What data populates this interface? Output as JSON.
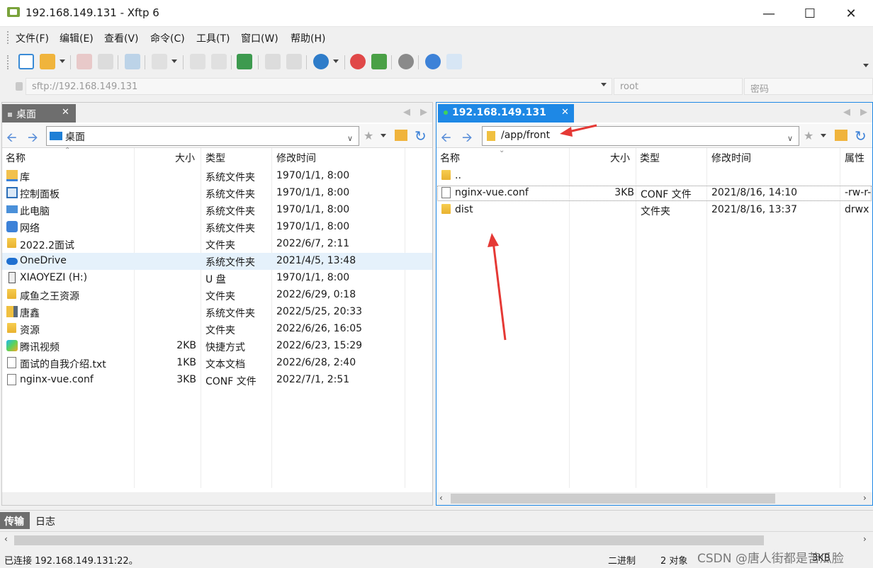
{
  "window": {
    "title": "192.168.149.131 - Xftp 6"
  },
  "menu": [
    "文件(F)",
    "编辑(E)",
    "查看(V)",
    "命令(C)",
    "工具(T)",
    "窗口(W)",
    "帮助(H)"
  ],
  "address": {
    "host": "sftp://192.168.149.131",
    "user": "root",
    "password": "密码"
  },
  "left": {
    "tab": "桌面",
    "path": "桌面",
    "columns": [
      "名称",
      "大小",
      "类型",
      "修改时间"
    ],
    "rows": [
      {
        "name": "库",
        "size": "",
        "type": "系统文件夹",
        "mtime": "1970/1/1, 8:00",
        "icon": "library-icon"
      },
      {
        "name": "控制面板",
        "size": "",
        "type": "系统文件夹",
        "mtime": "1970/1/1, 8:00",
        "icon": "control-panel-icon"
      },
      {
        "name": "此电脑",
        "size": "",
        "type": "系统文件夹",
        "mtime": "1970/1/1, 8:00",
        "icon": "computer-icon"
      },
      {
        "name": "网络",
        "size": "",
        "type": "系统文件夹",
        "mtime": "1970/1/1, 8:00",
        "icon": "network-icon"
      },
      {
        "name": "2022.2面试",
        "size": "",
        "type": "文件夹",
        "mtime": "2022/6/7, 2:11",
        "icon": "folder-icon"
      },
      {
        "name": "OneDrive",
        "size": "",
        "type": "系统文件夹",
        "mtime": "2021/4/5, 13:48",
        "icon": "cloud-icon"
      },
      {
        "name": "XIAOYEZI (H:)",
        "size": "",
        "type": "U 盘",
        "mtime": "1970/1/1, 8:00",
        "icon": "usb-drive-icon"
      },
      {
        "name": "咸鱼之王资源",
        "size": "",
        "type": "文件夹",
        "mtime": "2022/6/29, 0:18",
        "icon": "folder-icon"
      },
      {
        "name": "唐鑫",
        "size": "",
        "type": "系统文件夹",
        "mtime": "2022/5/25, 20:33",
        "icon": "user-folder-icon"
      },
      {
        "name": "资源",
        "size": "",
        "type": "文件夹",
        "mtime": "2022/6/26, 16:05",
        "icon": "folder-icon"
      },
      {
        "name": "腾讯视频",
        "size": "2KB",
        "type": "快捷方式",
        "mtime": "2022/6/23, 15:29",
        "icon": "video-shortcut-icon"
      },
      {
        "name": "面试的自我介绍.txt",
        "size": "1KB",
        "type": "文本文档",
        "mtime": "2022/6/28, 2:40",
        "icon": "text-file-icon"
      },
      {
        "name": "nginx-vue.conf",
        "size": "3KB",
        "type": "CONF 文件",
        "mtime": "2022/7/1, 2:51",
        "icon": "file-icon"
      }
    ]
  },
  "right": {
    "tab": "192.168.149.131",
    "path": "/app/front",
    "columns": [
      "名称",
      "大小",
      "类型",
      "修改时间",
      "属性"
    ],
    "rows": [
      {
        "name": "..",
        "size": "",
        "type": "",
        "mtime": "",
        "attr": "",
        "icon": "folder-icon"
      },
      {
        "name": "nginx-vue.conf",
        "size": "3KB",
        "type": "CONF 文件",
        "mtime": "2021/8/16, 14:10",
        "attr": "-rw-r-",
        "icon": "file-icon"
      },
      {
        "name": "dist",
        "size": "",
        "type": "文件夹",
        "mtime": "2021/8/16, 13:37",
        "attr": "drwx",
        "icon": "folder-icon"
      }
    ]
  },
  "bottom_tabs": [
    "传输",
    "日志"
  ],
  "status": {
    "left": "已连接 192.168.149.131:22。",
    "mode": "二进制",
    "count": "2 对象",
    "size": "3KB"
  },
  "watermark": "CSDN @唐人街都是苦瓜脸",
  "colors": {
    "accent": "#1e88e5",
    "selection": "#e5f1fb",
    "arrow": "#e53935"
  }
}
